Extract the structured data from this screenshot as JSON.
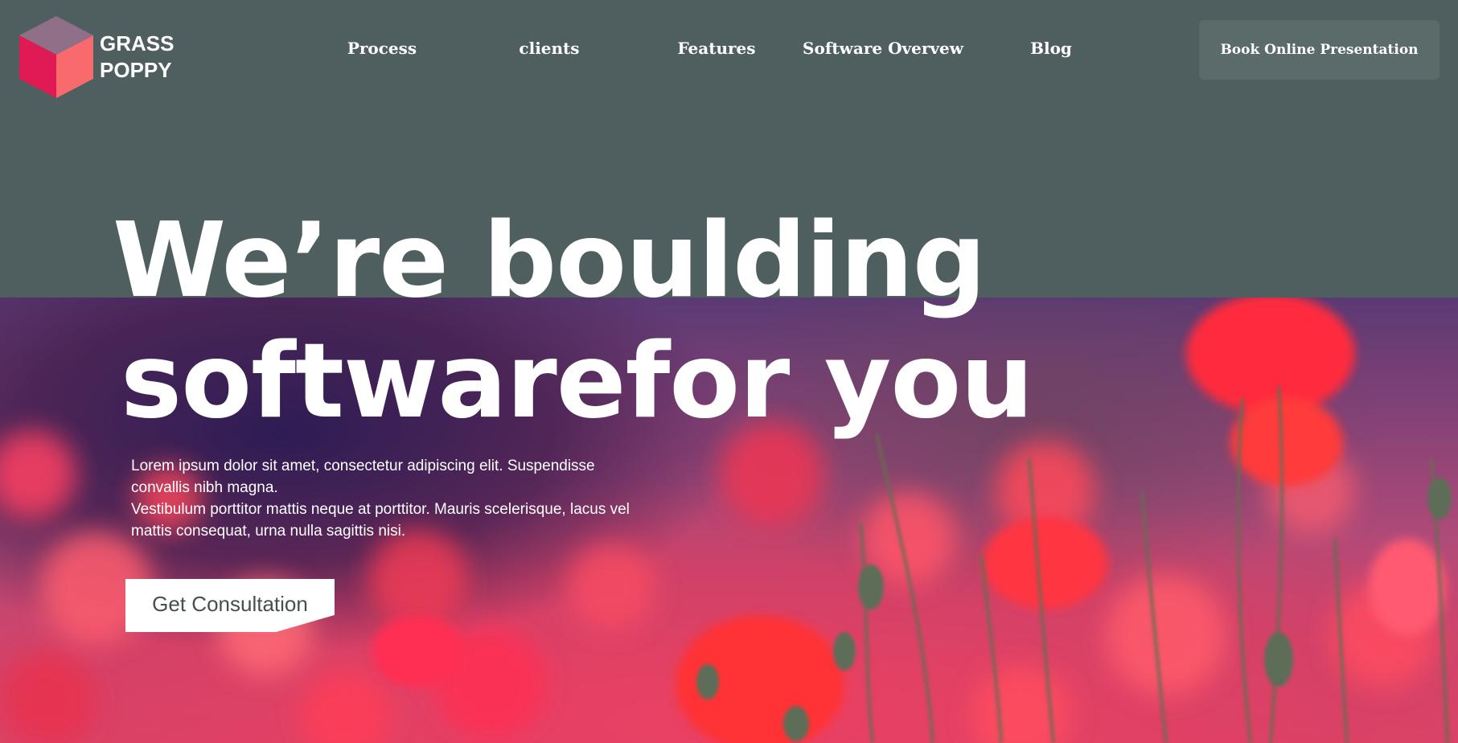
{
  "brand": {
    "name_line1": "GRASS",
    "name_line2": "POPPY",
    "logo_icon": "cube-icon",
    "colors": {
      "cube_top": "#8f7088",
      "cube_left": "#e01a52",
      "cube_right": "#f86a6c"
    }
  },
  "nav": {
    "items": [
      {
        "label": "Process"
      },
      {
        "label": "clients"
      },
      {
        "label": "Features"
      },
      {
        "label": "Software Overvew"
      },
      {
        "label": "Blog"
      }
    ],
    "cta_label": "Book Online Presentation"
  },
  "hero": {
    "headline_line1": "We’re boulding",
    "headline_line2": "softwarefor you",
    "paragraph_lines": [
      "Lorem ipsum dolor sit amet, consectetur adipiscing elit. Suspendisse",
      "convallis nibh magna.",
      "Vestibulum porttitor mattis neque at porttitor. Mauris scelerisque, lacus vel",
      "mattis consequat, urna nulla sagittis nisi."
    ],
    "button_label": "Get Consultation",
    "image": "poppy-field-photo"
  },
  "colors": {
    "header_background": "#4f5f5f",
    "nav_button_background": "#5b6b6a",
    "text": "#ffffff",
    "button_text": "#44504f"
  }
}
